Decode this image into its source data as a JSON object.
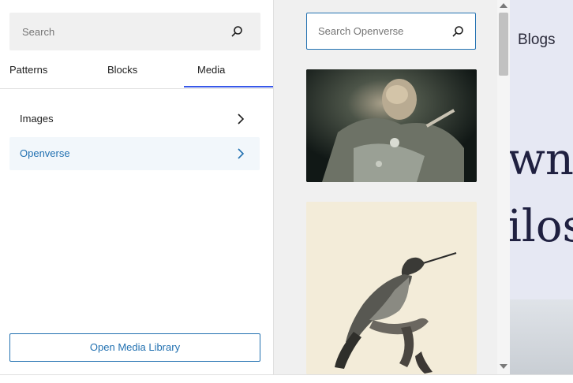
{
  "inserter": {
    "search": {
      "placeholder": "Search"
    },
    "tabs": [
      {
        "label": "Patterns"
      },
      {
        "label": "Blocks"
      },
      {
        "label": "Media",
        "active": true
      }
    ],
    "media_categories": [
      {
        "label": "Images"
      },
      {
        "label": "Openverse",
        "active": true
      }
    ],
    "open_media_library_label": "Open Media Library"
  },
  "openverse": {
    "search": {
      "placeholder": "Search Openverse"
    }
  },
  "canvas": {
    "nav_item": "Blogs",
    "heading_fragments": [
      "wn:",
      "ilos"
    ]
  },
  "colors": {
    "accent": "#2271b1",
    "tab_indicator": "#3858e9",
    "active_row_bg": "#f2f7fb"
  },
  "icons": {
    "search": "search-icon",
    "chevron": "chevron-right-icon"
  }
}
